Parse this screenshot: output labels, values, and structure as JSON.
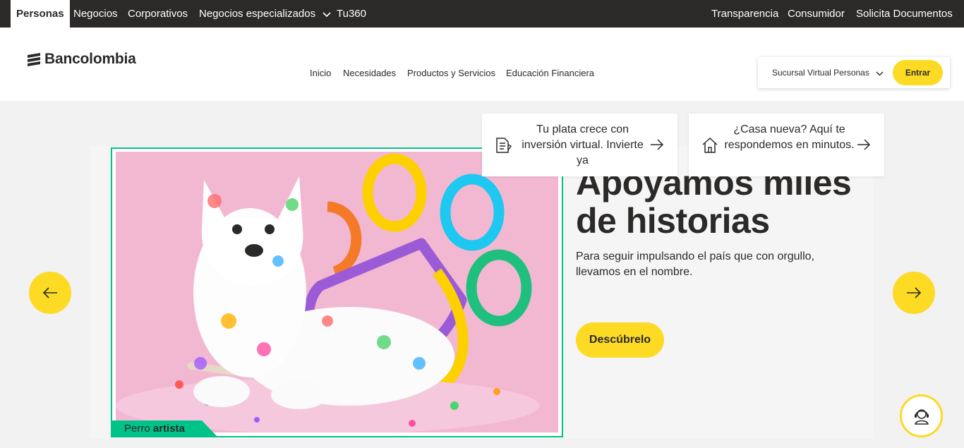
{
  "topbar": {
    "items": [
      {
        "label": "Personas"
      },
      {
        "label": "Negocios"
      },
      {
        "label": "Corporativos"
      },
      {
        "label": "Negocios especializados"
      },
      {
        "label": "Tu360"
      }
    ],
    "right_items": [
      {
        "label": "Transparencia"
      },
      {
        "label": "Consumidor"
      },
      {
        "label": "Solicita Documentos"
      }
    ],
    "dropdown_icon": "chevron-down-icon"
  },
  "header": {
    "logo_text": "Bancolombia",
    "nav": [
      {
        "label": "Inicio"
      },
      {
        "label": "Necesidades"
      },
      {
        "label": "Productos y Servicios"
      },
      {
        "label": "Educación Financiera"
      }
    ],
    "login": {
      "select_label": "Sucursal Virtual Personas",
      "enter_label": "Entrar"
    }
  },
  "hero": {
    "headline": "Apoyamos miles de historias",
    "subtext": "Para seguir impulsando el país que con orgullo, llevamos en el nombre.",
    "cta_label": "Descúbrelo",
    "photo_tag_normal": "Perro",
    "photo_tag_bold": "artista",
    "prev_icon": "arrow-left-icon",
    "next_icon": "arrow-right-icon"
  },
  "quick_cards": [
    {
      "text": "Tu plata crece con inversión virtual. Invierte ya",
      "icon": "document-icon"
    },
    {
      "text": "¿Casa nueva? Aquí te respondemos en minutos.",
      "icon": "house-icon"
    }
  ],
  "help_icon": "support-agent-icon",
  "colors": {
    "brand_yellow": "#fdda24",
    "dark": "#2c2a29",
    "accent_green": "#00c389",
    "photo_pink": "#f2b8d2"
  }
}
